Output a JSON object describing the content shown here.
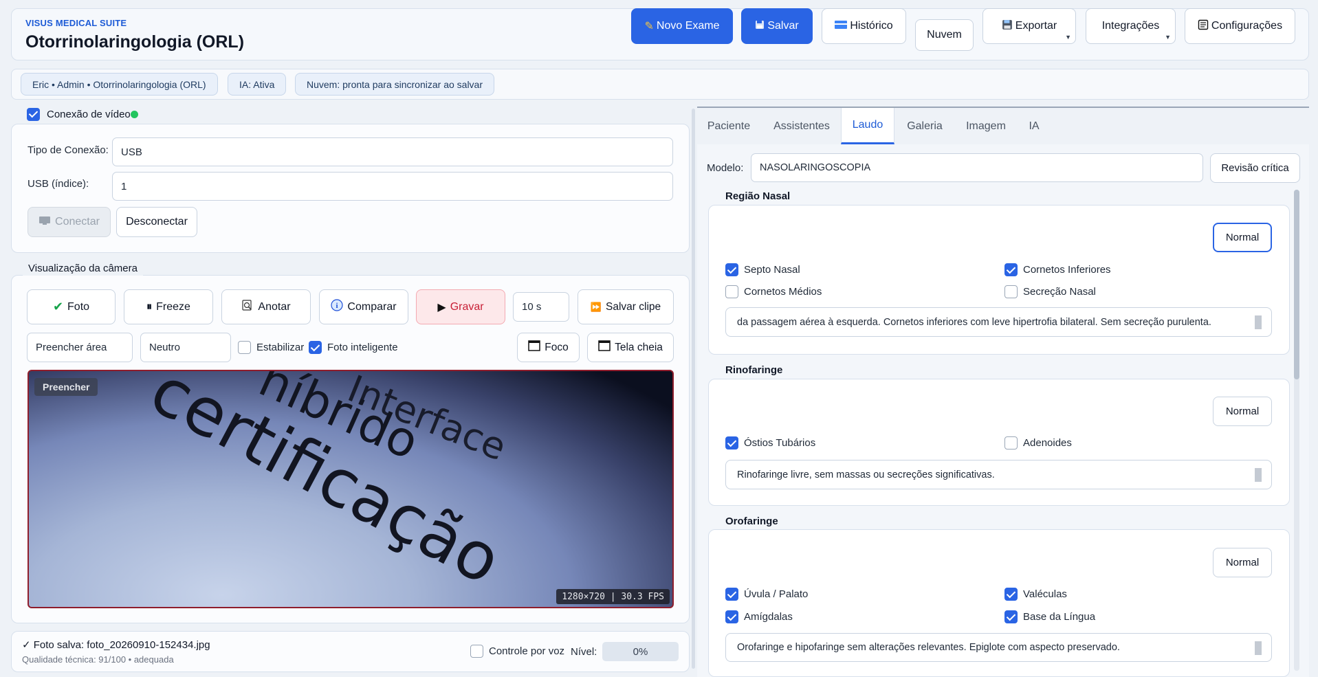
{
  "header": {
    "brand": "VISUS MEDICAL SUITE",
    "title": "Otorrinolaringologia (ORL)",
    "buttons": {
      "novo_exame": "Novo Exame",
      "salvar": "Salvar",
      "historico": "Histórico",
      "nuvem": "Nuvem",
      "exportar": "Exportar",
      "integracoes": "Integrações",
      "configuracoes": "Configurações"
    }
  },
  "status": {
    "user": "Eric • Admin • Otorrinolaringologia (ORL)",
    "ia": "IA: Ativa",
    "nuvem": "Nuvem: pronta para sincronizar ao salvar"
  },
  "video": {
    "toggle_label": "Conexão de vídeo",
    "tipo_label": "Tipo de Conexão:",
    "tipo_value": "USB",
    "usb_label": "USB (índice):",
    "usb_value": "1",
    "conectar": "Conectar",
    "desconectar": "Desconectar"
  },
  "camera": {
    "legend": "Visualização da câmera",
    "foto": "Foto",
    "freeze": "Freeze",
    "anotar": "Anotar",
    "comparar": "Comparar",
    "gravar": "Gravar",
    "duration": "10 s",
    "salvar_clipe": "Salvar clipe",
    "preencher": "Preencher área",
    "neutro": "Neutro",
    "estabilizar": "Estabilizar",
    "foto_inteligente": "Foto inteligente",
    "foco": "Foco",
    "tela_cheia": "Tela cheia",
    "overlay_mode": "Preencher",
    "feed_words": [
      "Interface",
      "híbrido",
      "certificação"
    ],
    "resolution": "1280×720 | 30.3 FPS"
  },
  "footer": {
    "saved": "✓ Foto salva: foto_20260910-152434.jpg",
    "quality": "Qualidade técnica: 91/100 • adequada",
    "voice": "Controle por voz",
    "nivel_label": "Nível:",
    "nivel_value": "0%"
  },
  "tabs": [
    "Paciente",
    "Assistentes",
    "Laudo",
    "Galeria",
    "Imagem",
    "IA"
  ],
  "laudo": {
    "modelo_label": "Modelo:",
    "modelo_value": "NASOLARINGOSCOPIA",
    "revisao": "Revisão crítica",
    "normal": "Normal",
    "sections": [
      {
        "title": "Região Nasal",
        "checks": [
          {
            "label": "Septo Nasal",
            "checked": true
          },
          {
            "label": "Cornetos Inferiores",
            "checked": true
          },
          {
            "label": "Cornetos Médios",
            "checked": false
          },
          {
            "label": "Secreção Nasal",
            "checked": false
          }
        ],
        "text": "da passagem aérea à esquerda. Cornetos inferiores com leve hipertrofia bilateral. Sem secreção purulenta."
      },
      {
        "title": "Rinofaringe",
        "checks": [
          {
            "label": "Óstios Tubários",
            "checked": true
          },
          {
            "label": "Adenoides",
            "checked": false
          }
        ],
        "text": "Rinofaringe livre, sem massas ou secreções significativas."
      },
      {
        "title": "Orofaringe",
        "checks": [
          {
            "label": "Úvula / Palato",
            "checked": true
          },
          {
            "label": "Valéculas",
            "checked": true
          },
          {
            "label": "Amígdalas",
            "checked": true
          },
          {
            "label": "Base da Língua",
            "checked": true
          }
        ],
        "text": "Orofaringe e hipofaringe sem alterações relevantes. Epiglote com aspecto preservado."
      }
    ]
  }
}
